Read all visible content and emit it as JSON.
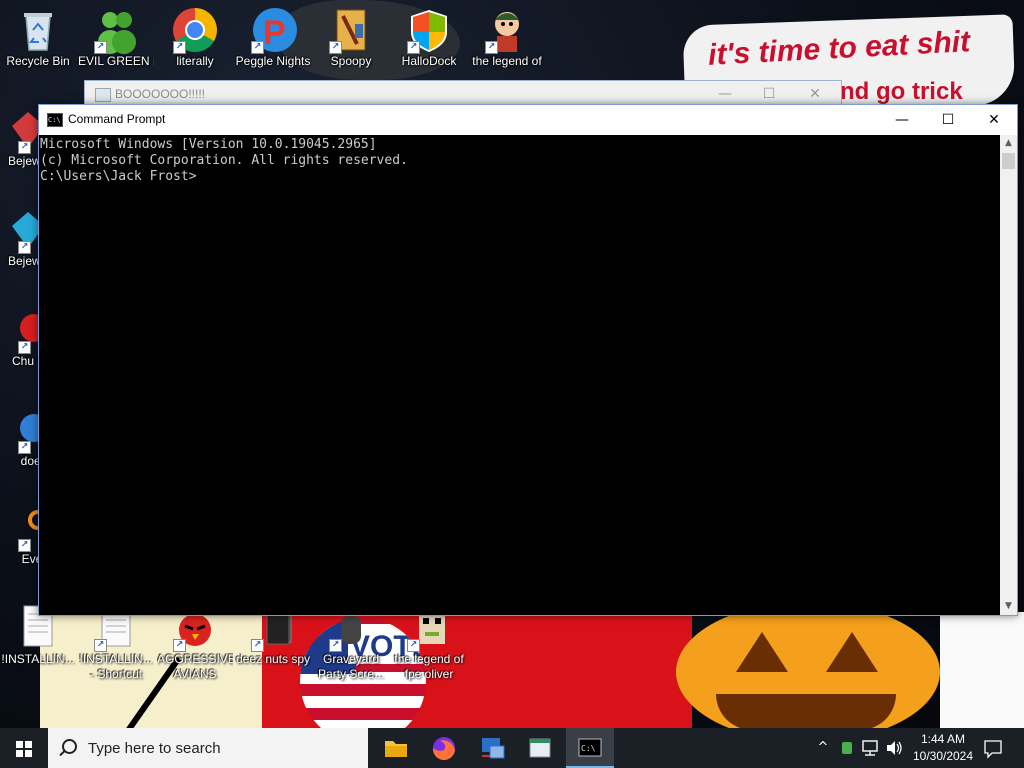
{
  "wallpaper": {
    "sign_line1": "it's time to eat shit",
    "sign_line2": "nd go trick",
    "sign_line2_prefix": "and",
    "vote_text": "VOTE"
  },
  "desktop_icons": [
    {
      "label": "Recycle Bin",
      "icon": "recycle-bin-icon"
    },
    {
      "label": "EVIL GREEN MEN CO...",
      "icon": "green-men-icon"
    },
    {
      "label": "literally",
      "icon": "chrome-icon"
    },
    {
      "label": "Peggle Nights",
      "icon": "peggle-icon"
    },
    {
      "label": "Spoopy",
      "icon": "spoopy-icon"
    },
    {
      "label": "HalloDock",
      "icon": "hallodock-icon"
    },
    {
      "label": "the legend of",
      "icon": "legend-icon"
    },
    {
      "label": "Bejew Delu",
      "icon": "bejeweled-icon"
    },
    {
      "label": "Bejew Delu",
      "icon": "bejeweled-icon"
    },
    {
      "label": "Chu Delu",
      "icon": "chuzzle-icon"
    },
    {
      "label": "doesn",
      "icon": "doesn-icon"
    },
    {
      "label": "Every",
      "icon": "every-icon"
    },
    {
      "label": "!INSTALLIN...",
      "icon": "document-icon"
    },
    {
      "label": "!INSTALLIN... - Shortcut",
      "icon": "document-icon"
    },
    {
      "label": "AGGRESSIVE AVIANS",
      "icon": "angry-bird-icon"
    },
    {
      "label": "deez nuts spy",
      "icon": "spy-icon"
    },
    {
      "label": "Graveyard Party Scre...",
      "icon": "graveyard-icon"
    },
    {
      "label": "the legend of fpe oliver",
      "icon": "oliver-icon"
    }
  ],
  "background_window": {
    "title": "BOOOOOOO!!!!!",
    "minimize": "—",
    "maximize": "☐",
    "close": "✕"
  },
  "cmd_window": {
    "title": "Command Prompt",
    "icon_glyph": "C:\\",
    "minimize": "—",
    "maximize": "☐",
    "close": "✕",
    "lines": [
      "Microsoft Windows [Version 10.0.19045.2965]",
      "(c) Microsoft Corporation. All rights reserved.",
      "",
      "C:\\Users\\Jack Frost>"
    ],
    "scroll_up": "▲",
    "scroll_down": "▼"
  },
  "taskbar": {
    "search_placeholder": "Type here to search",
    "pinned_apps": [
      {
        "name": "file-explorer",
        "icon": "folder-icon"
      },
      {
        "name": "firefox",
        "icon": "firefox-icon"
      },
      {
        "name": "network-app",
        "icon": "network-icon"
      },
      {
        "name": "window-app",
        "icon": "window-icon"
      },
      {
        "name": "command-prompt",
        "icon": "cmd-icon",
        "active": true
      }
    ],
    "tray": {
      "chevron": "^",
      "time": "1:44 AM",
      "date": "10/30/2024"
    }
  },
  "colors": {
    "taskbar": "#1b1f26",
    "cmd_background": "#000000",
    "cmd_text": "#cccccc",
    "sign_text": "#c8102e",
    "pumpkin": "#f4a01c"
  }
}
